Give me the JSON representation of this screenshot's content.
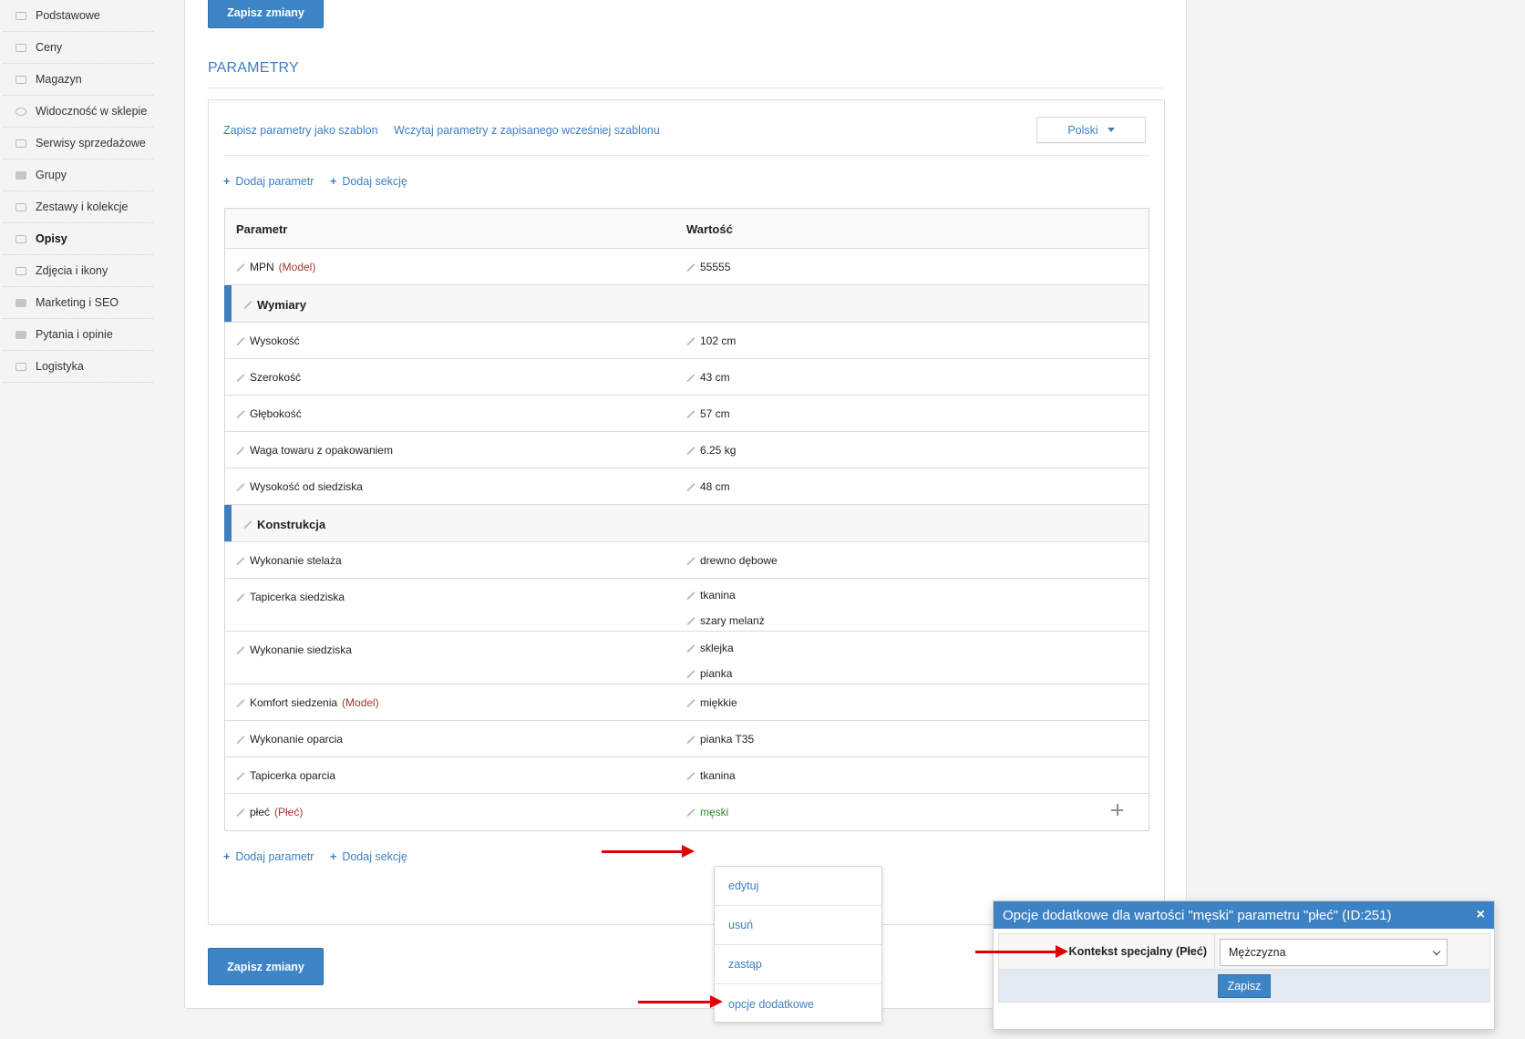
{
  "sidebar": {
    "items": [
      {
        "label": "Podstawowe",
        "icon": "box-icon",
        "active": false
      },
      {
        "label": "Ceny",
        "icon": "tag-icon",
        "active": false
      },
      {
        "label": "Magazyn",
        "icon": "warehouse-icon",
        "active": false
      },
      {
        "label": "Widoczność w sklepie",
        "icon": "eye-icon",
        "active": false
      },
      {
        "label": "Serwisy sprzedażowe",
        "icon": "gavel-icon",
        "active": false
      },
      {
        "label": "Grupy",
        "icon": "layers-icon",
        "active": false
      },
      {
        "label": "Zestawy i kolekcje",
        "icon": "collection-icon",
        "active": false
      },
      {
        "label": "Opisy",
        "icon": "list-icon",
        "active": true
      },
      {
        "label": "Zdjęcia i ikony",
        "icon": "camera-icon",
        "active": false
      },
      {
        "label": "Marketing i SEO",
        "icon": "megaphone-icon",
        "active": false
      },
      {
        "label": "Pytania i opinie",
        "icon": "comments-icon",
        "active": false
      },
      {
        "label": "Logistyka",
        "icon": "plane-icon",
        "active": false
      }
    ]
  },
  "main": {
    "save_label": "Zapisz zmiany",
    "section_title": "PARAMETRY",
    "save_template_link": "Zapisz parametry jako szablon",
    "load_template_link": "Wczytaj parametry z zapisanego wcześniej szablonu",
    "language": "Polski",
    "add_param": "Dodaj parametr",
    "add_section": "Dodaj sekcję",
    "table": {
      "header": {
        "param": "Parametr",
        "value": "Wartość"
      },
      "rows": [
        {
          "type": "param",
          "name": "MPN",
          "tag": "(Model)",
          "values": [
            "55555"
          ]
        },
        {
          "type": "section",
          "name": "Wymiary"
        },
        {
          "type": "param",
          "name": "Wysokość",
          "tag": "",
          "values": [
            "102 cm"
          ]
        },
        {
          "type": "param",
          "name": "Szerokość",
          "tag": "",
          "values": [
            "43 cm"
          ]
        },
        {
          "type": "param",
          "name": "Głębokość",
          "tag": "",
          "values": [
            "57 cm"
          ]
        },
        {
          "type": "param",
          "name": "Waga towaru z opakowaniem",
          "tag": "",
          "values": [
            "6.25 kg"
          ]
        },
        {
          "type": "param",
          "name": "Wysokość od siedziska",
          "tag": "",
          "values": [
            "48 cm"
          ]
        },
        {
          "type": "section",
          "name": "Konstrukcja"
        },
        {
          "type": "param",
          "name": "Wykonanie stelaża",
          "tag": "",
          "values": [
            "drewno dębowe"
          ]
        },
        {
          "type": "param",
          "name": "Tapicerka siedziska",
          "tag": "",
          "values": [
            "tkanina",
            "szary melanż"
          ]
        },
        {
          "type": "param",
          "name": "Wykonanie siedziska",
          "tag": "",
          "values": [
            "sklejka",
            "pianka"
          ]
        },
        {
          "type": "param",
          "name": "Komfort siedzenia",
          "tag": "(Model)",
          "values": [
            "miękkie"
          ]
        },
        {
          "type": "param",
          "name": "Wykonanie oparcia",
          "tag": "",
          "values": [
            "pianka T35"
          ]
        },
        {
          "type": "param",
          "name": "Tapicerka oparcia",
          "tag": "",
          "values": [
            "tkanina"
          ]
        },
        {
          "type": "param",
          "name": "płeć",
          "tag": "(Płeć)",
          "values": [
            "męski"
          ],
          "highlight": true
        }
      ]
    }
  },
  "context_menu": {
    "items": [
      "edytuj",
      "usuń",
      "zastąp",
      "opcje dodatkowe"
    ]
  },
  "dialog": {
    "title": "Opcje dodatkowe dla wartości \"męski\" parametru \"płeć\" (ID:251)",
    "close": "×",
    "label": "Kontekst specjalny (Płeć)",
    "select_value": "Mężczyzna",
    "save": "Zapisz"
  },
  "colors": {
    "accent": "#3d7fc1",
    "tag_red": "#a0382f",
    "value_green": "#2e8b2e",
    "arrow": "#e00000"
  }
}
